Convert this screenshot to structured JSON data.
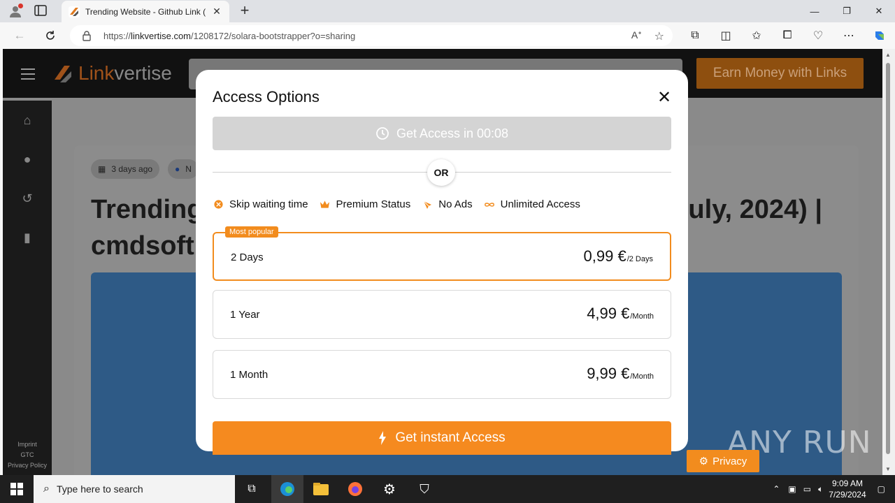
{
  "browser": {
    "tab_title": "Trending Website - Github Link (",
    "url_prefix": "https://",
    "url_host": "linkvertise.com",
    "url_path": "/1208172/solara-bootstrapper?o=sharing"
  },
  "site": {
    "logo_brand_1": "Link",
    "logo_brand_2": "vertise",
    "earn_button": "Earn Money with Links",
    "footer_links": [
      "Imprint",
      "GTC",
      "Privacy Policy"
    ],
    "meta_date": "3 days ago",
    "meta_second": "N",
    "heading_left_line1": "Trending",
    "heading_left_line2": "cmdsoft",
    "heading_right": "uly, 2024) |",
    "privacy_button": "Privacy"
  },
  "modal": {
    "title": "Access Options",
    "wait_button": "Get Access in 00:08",
    "or_label": "OR",
    "features": [
      {
        "label": "Skip waiting time",
        "icon": "skip-icon"
      },
      {
        "label": "Premium Status",
        "icon": "crown-icon"
      },
      {
        "label": "No Ads",
        "icon": "no-ads-icon"
      },
      {
        "label": "Unlimited Access",
        "icon": "infinity-icon"
      }
    ],
    "plans": [
      {
        "name": "2 Days",
        "price": "0,99 €",
        "period": "/2 Days",
        "badge": "Most popular"
      },
      {
        "name": "1 Year",
        "price": "4,99 €",
        "period": "/Month"
      },
      {
        "name": "1 Month",
        "price": "9,99 €",
        "period": "/Month"
      }
    ],
    "cta": "Get instant Access"
  },
  "watermark": "ANY RUN",
  "taskbar": {
    "search_placeholder": "Type here to search",
    "time": "9:09 AM",
    "date": "7/29/2024"
  },
  "colors": {
    "accent": "#f58a1f",
    "disabled": "#d4d4d4"
  }
}
